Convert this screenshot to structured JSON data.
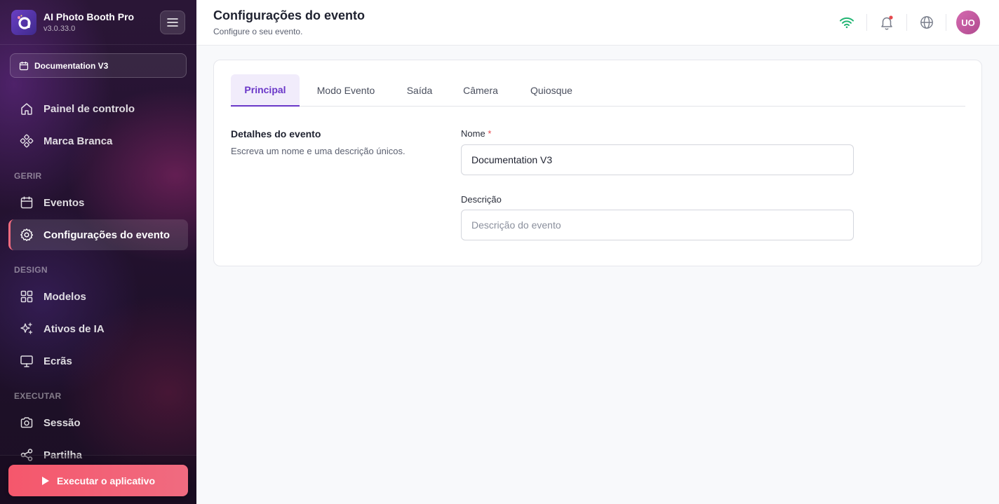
{
  "app": {
    "name": "AI Photo Booth Pro",
    "version": "v3.0.33.0"
  },
  "sidebar": {
    "event_selector": "Documentation V3",
    "items_top": [
      {
        "label": "Painel de controlo",
        "icon": "home-icon"
      },
      {
        "label": "Marca Branca",
        "icon": "brand-icon"
      }
    ],
    "sections": [
      {
        "title": "GERIR",
        "items": [
          {
            "label": "Eventos",
            "icon": "calendar-icon"
          },
          {
            "label": "Configurações do evento",
            "icon": "gear-icon",
            "active": true
          }
        ]
      },
      {
        "title": "DESIGN",
        "items": [
          {
            "label": "Modelos",
            "icon": "grid-icon"
          },
          {
            "label": "Ativos de IA",
            "icon": "sparkles-icon"
          },
          {
            "label": "Ecrãs",
            "icon": "monitor-icon"
          }
        ]
      },
      {
        "title": "EXECUTAR",
        "items": [
          {
            "label": "Sessão",
            "icon": "camera-icon"
          },
          {
            "label": "Partilha",
            "icon": "share-icon"
          }
        ]
      }
    ],
    "run_button": "Executar o aplicativo"
  },
  "header": {
    "title": "Configurações do evento",
    "subtitle": "Configure o seu evento.",
    "avatar_initials": "UO",
    "status_color": "#22b573",
    "notification_dot_color": "#e5484d"
  },
  "tabs": [
    {
      "label": "Principal",
      "active": true
    },
    {
      "label": "Modo Evento"
    },
    {
      "label": "Saída"
    },
    {
      "label": "Câmera"
    },
    {
      "label": "Quiosque"
    }
  ],
  "form": {
    "section_title": "Detalhes do evento",
    "section_desc": "Escreva um nome e uma descrição únicos.",
    "name_label": "Nome",
    "name_required": "*",
    "name_value": "Documentation V3",
    "desc_label": "Descrição",
    "desc_placeholder": "Descrição do evento",
    "desc_value": ""
  },
  "colors": {
    "accent": "#6a37c8",
    "run_button": "#f5576c"
  }
}
